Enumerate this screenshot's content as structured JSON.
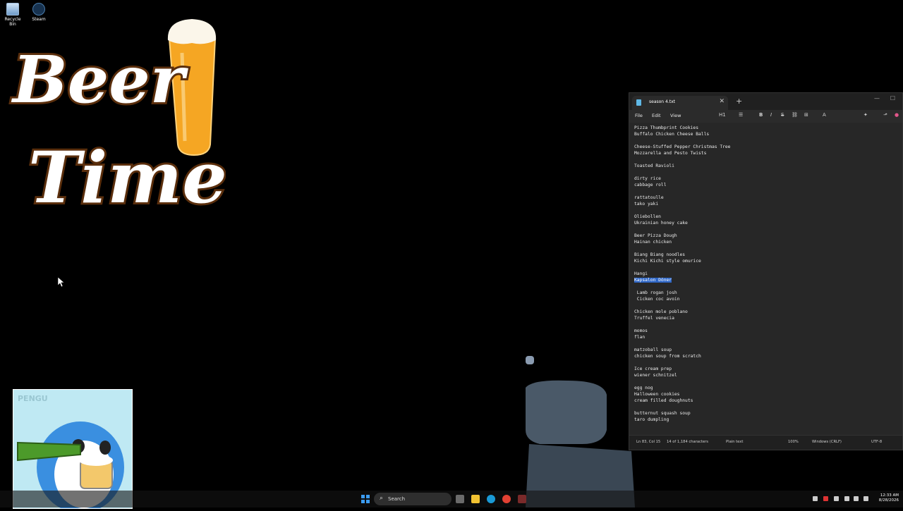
{
  "desktop": {
    "icons": [
      {
        "label": "Recycle Bin"
      },
      {
        "label": "Steam"
      }
    ],
    "wallpaper": {
      "logo_line1": "Beer",
      "logo_line2": "Time",
      "sticker_watermark": "PENGU"
    }
  },
  "notepad": {
    "tab_title": "season 4.txt",
    "menu": {
      "file": "File",
      "edit": "Edit",
      "view": "View"
    },
    "toolbar": {
      "heading": "H1"
    },
    "lines": [
      "Pizza Thumbprint Cookies",
      "Buffalo Chicken Cheese Balls",
      "",
      "Cheese-Stuffed Pepper Christmas Tree",
      "Mozzarella and Pesto Twists",
      "",
      "Toasted Ravioli",
      "",
      "dirty rice",
      "cabbage roll",
      "",
      "rattatoulle",
      "tako yaki",
      "",
      "Oliebollen",
      "Ukrainian honey cake",
      "",
      "Beer Pizza Dough",
      "Hainan chicken",
      "",
      "Biang Biang noodles",
      "Kichi Kichi style omurice",
      "",
      "Hangi",
      "Kapsalon Döner",
      "",
      " Lamb rogan josh",
      " Cicken coc avoin",
      "",
      "Chicken mole poblano",
      "Truffel venecia",
      "",
      "momos",
      "flan",
      "",
      "matzoball soup",
      "chicken soup from scratch",
      "",
      "Ice cream prep",
      "wiener schnitzel",
      "",
      "egg nog",
      "Halloween cookies",
      "cream filled doughnuts",
      "",
      "butternut squash soup",
      "taro dumpling"
    ],
    "selected_line_index": 24,
    "status": {
      "position": "Ln 83, Col 15",
      "chars": "14 of 1,184 characters",
      "format": "Plain text",
      "zoom": "100%",
      "eol": "Windows (CRLF)",
      "encoding": "UTF-8"
    }
  },
  "taskbar": {
    "search_label": "Search",
    "clock_time": "12:33 AM",
    "clock_date": "8/28/2026"
  }
}
